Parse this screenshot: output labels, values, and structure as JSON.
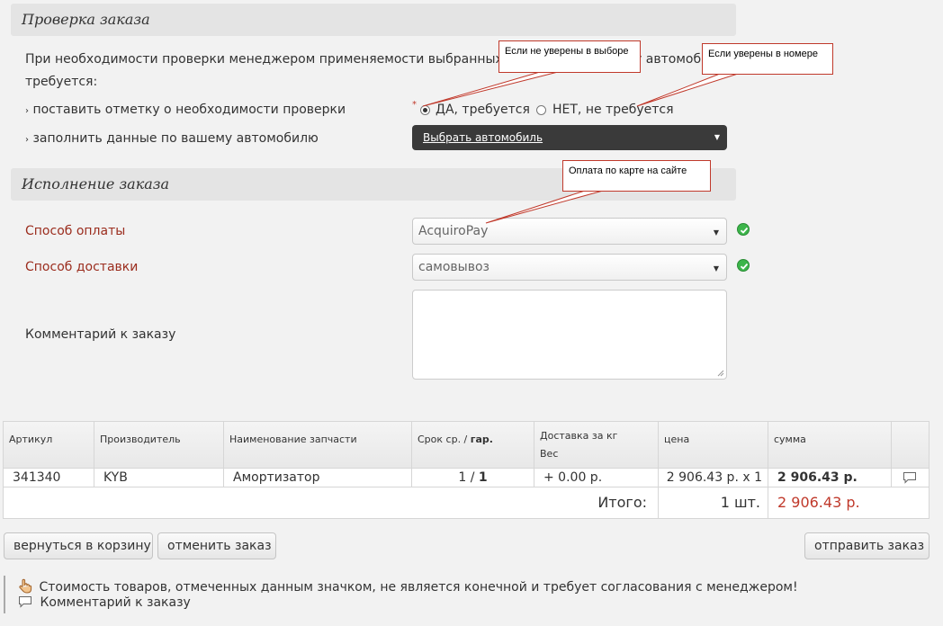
{
  "sections": {
    "check": {
      "title": "Проверка заказа"
    },
    "execution": {
      "title": "Исполнение заказа"
    }
  },
  "check": {
    "intro_line1": "При необходимости проверки менеджером применяемости выбранных запчастей к вашему автомобилю",
    "intro_line2": "требуется:",
    "row1_label": "поставить отметку о необходимости проверки",
    "required_mark": "*",
    "radio_yes": "ДА, требуется",
    "radio_no": "НЕТ, не требуется",
    "radio_selected": "yes",
    "row2_label": "заполнить данные по вашему автомобилю",
    "car_select": "Выбрать автомобиль"
  },
  "callouts": {
    "unsure": "Если не уверены в выборе",
    "sure": "Если уверены в номере",
    "payment": "Оплата по карте на сайте"
  },
  "execution": {
    "payment_label": "Способ оплаты",
    "payment_value": "AcquiroPay",
    "delivery_label": "Способ доставки",
    "delivery_value": "самовывоз",
    "comment_label": "Комментарий к заказу",
    "comment_value": ""
  },
  "table": {
    "headers": {
      "article": "Артикул",
      "maker": "Производитель",
      "name": "Наименование запчасти",
      "term": "Срок ср. /",
      "term_bold": "гар.",
      "delivery": "Доставка за кг",
      "weight": "Вес",
      "price": "цена",
      "sum": "сумма"
    },
    "rows": [
      {
        "article": "341340",
        "maker": "KYB",
        "name": "Амортизатор",
        "term": "1 /",
        "term_bold": "1",
        "delivery": "+ 0.00 р.",
        "price": "2 906.43 р. x 1",
        "sum": "2 906.43 р."
      }
    ],
    "total_label": "Итого:",
    "total_qty": "1 шт.",
    "total_sum": "2 906.43 р."
  },
  "buttons": {
    "back": "вернуться в корзину",
    "cancel": "отменить заказ",
    "submit": "отправить заказ"
  },
  "notes": {
    "hand": "Стоимость товаров, отмеченных данным значком, не является конечной и требует согласования с менеджером!",
    "comment": "Комментарий к заказу"
  },
  "icons": {
    "check": "check-circle-icon",
    "hand": "hand-pointer-icon",
    "comment": "speech-bubble-icon"
  },
  "colors": {
    "accent_red": "#9b2d1e",
    "total_red": "#c0392b",
    "ok_green": "#3cb54a",
    "dark_select": "#3a3a3a"
  }
}
